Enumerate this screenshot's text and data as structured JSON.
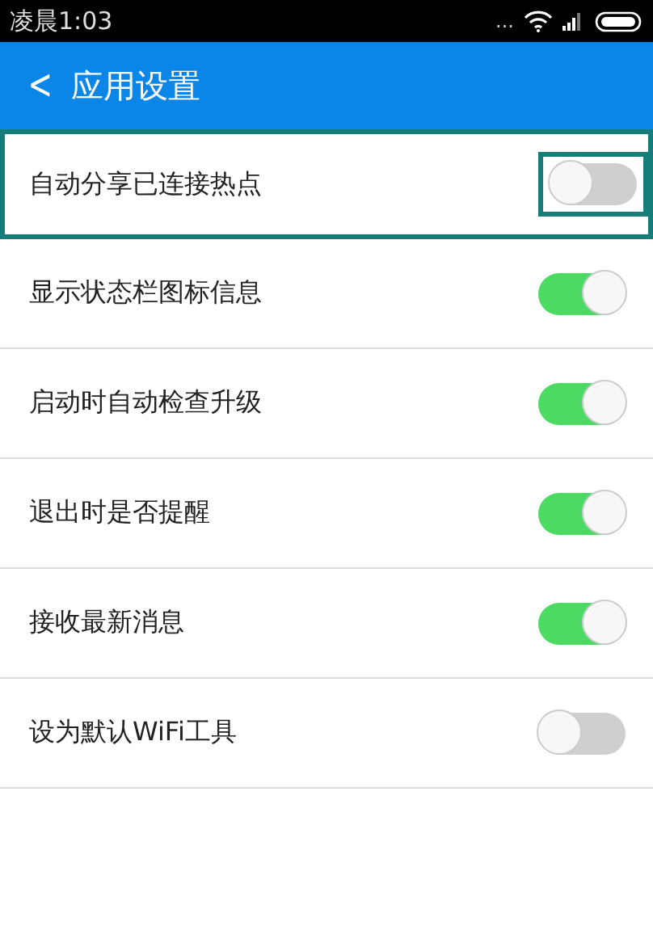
{
  "status_bar": {
    "time": "凌晨1:03",
    "dots": "..."
  },
  "header": {
    "back": "<",
    "title": "应用设置"
  },
  "settings": [
    {
      "label": "自动分享已连接热点",
      "on": false,
      "highlighted": true
    },
    {
      "label": "显示状态栏图标信息",
      "on": true,
      "highlighted": false
    },
    {
      "label": "启动时自动检查升级",
      "on": true,
      "highlighted": false
    },
    {
      "label": "退出时是否提醒",
      "on": true,
      "highlighted": false
    },
    {
      "label": "接收最新消息",
      "on": true,
      "highlighted": false
    },
    {
      "label": "设为默认WiFi工具",
      "on": false,
      "highlighted": false
    }
  ]
}
